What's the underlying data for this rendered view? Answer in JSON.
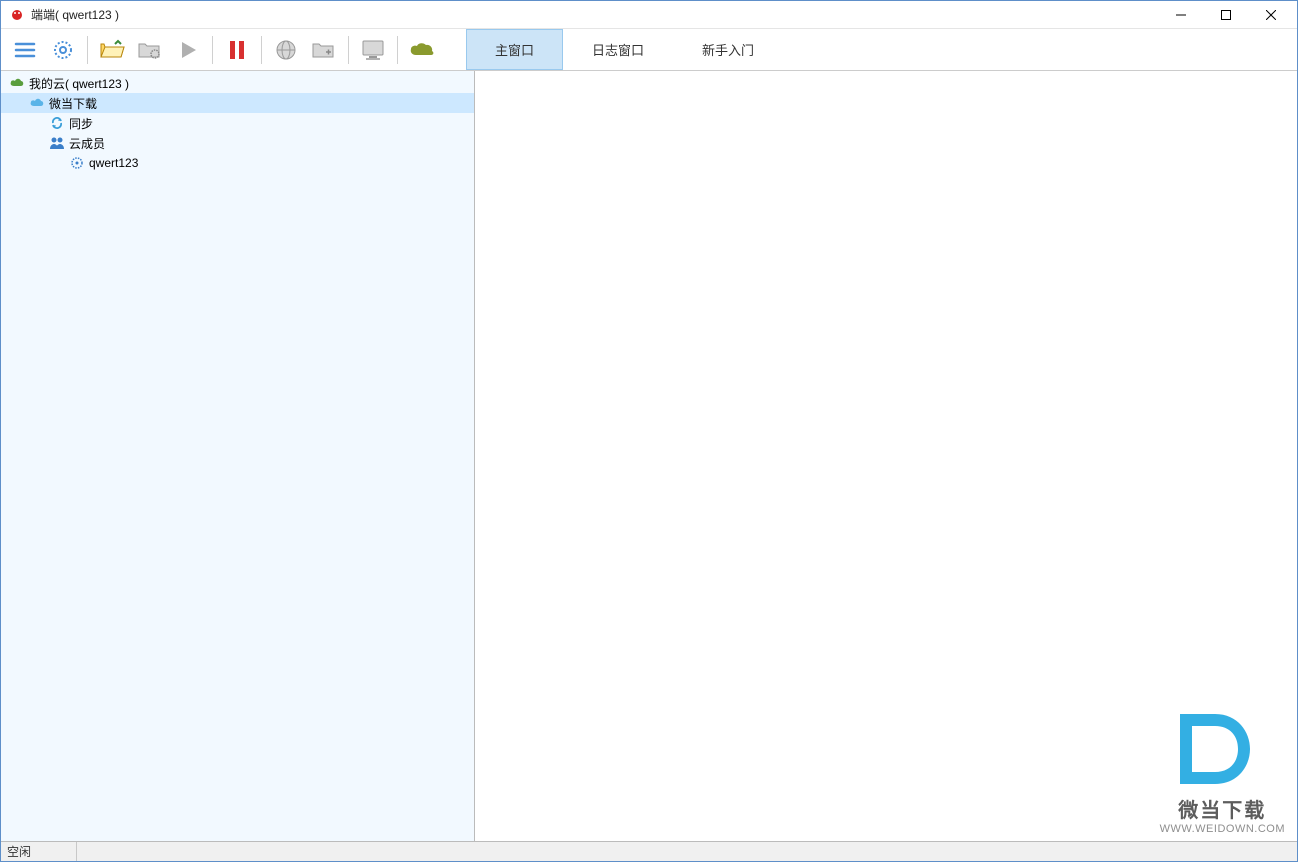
{
  "window": {
    "title": "端端( qwert123 )"
  },
  "toolbar": {
    "icons": {
      "menu": "menu",
      "gear": "gear",
      "open_folder": "open-folder",
      "folder_gear": "folder-gear",
      "play": "play",
      "pause": "pause",
      "globe": "globe",
      "folder_open2": "folder-open",
      "monitor": "monitor",
      "cloud": "cloud"
    }
  },
  "tabs": [
    {
      "label": "主窗口",
      "active": true
    },
    {
      "label": "日志窗口",
      "active": false
    },
    {
      "label": "新手入门",
      "active": false
    }
  ],
  "tree": {
    "root": {
      "label": "我的云( qwert123 )",
      "icon": "cloud-green"
    },
    "items": [
      {
        "label": "微当下载",
        "icon": "cloud-blue",
        "indent": 1,
        "selected": true
      },
      {
        "label": "同步",
        "icon": "sync",
        "indent": 2,
        "selected": false
      },
      {
        "label": "云成员",
        "icon": "users",
        "indent": 2,
        "selected": false
      },
      {
        "label": "qwert123",
        "icon": "gear-small",
        "indent": 3,
        "selected": false
      }
    ]
  },
  "statusbar": {
    "text": "空闲"
  },
  "watermark": {
    "brand": "微当下载",
    "url": "WWW.WEIDOWN.COM"
  }
}
